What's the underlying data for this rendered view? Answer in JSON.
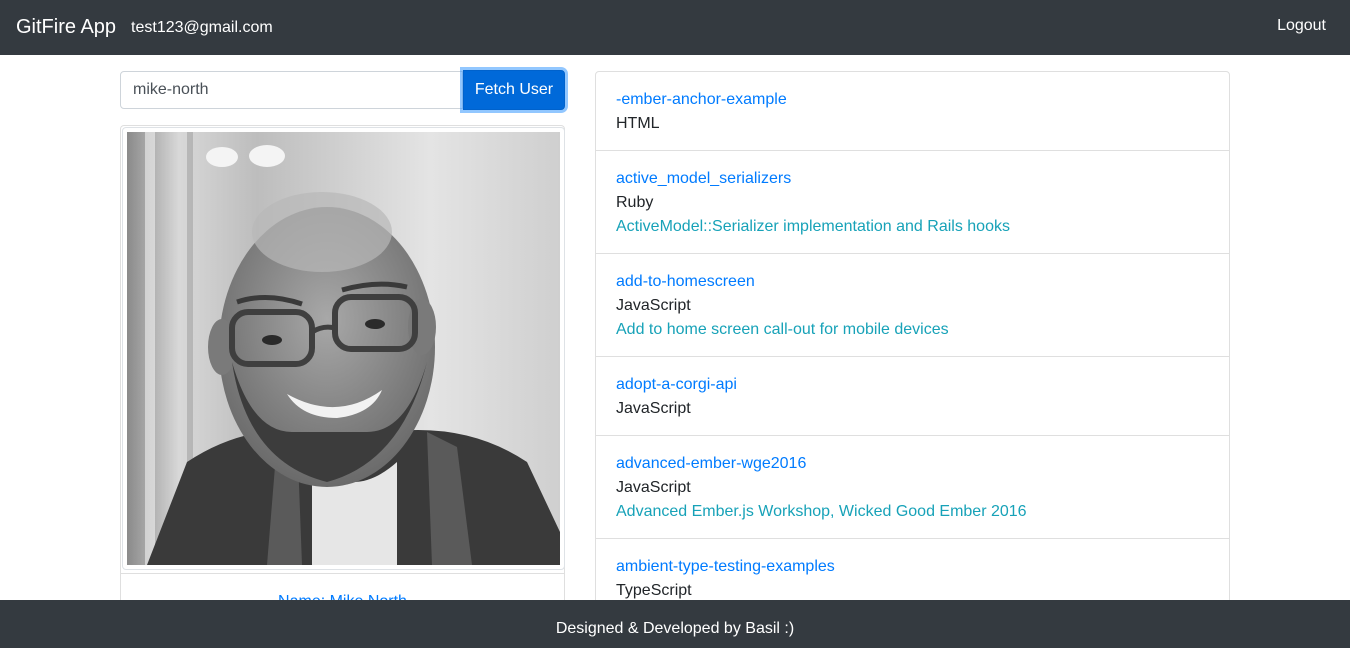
{
  "navbar": {
    "brand": "GitFire App",
    "user_email": "test123@gmail.com",
    "logout_label": "Logout"
  },
  "search": {
    "value": "mike-north",
    "button_label": "Fetch User"
  },
  "profile": {
    "photo_alt": "user avatar",
    "name_label": "Name: Mike North"
  },
  "repos": [
    {
      "name": "-ember-anchor-example",
      "language": "HTML",
      "description": ""
    },
    {
      "name": "active_model_serializers",
      "language": "Ruby",
      "description": "ActiveModel::Serializer implementation and Rails hooks"
    },
    {
      "name": "add-to-homescreen",
      "language": "JavaScript",
      "description": "Add to home screen call-out for mobile devices"
    },
    {
      "name": "adopt-a-corgi-api",
      "language": "JavaScript",
      "description": ""
    },
    {
      "name": "advanced-ember-wge2016",
      "language": "JavaScript",
      "description": "Advanced Ember.js Workshop, Wicked Good Ember 2016"
    },
    {
      "name": "ambient-type-testing-examples",
      "language": "TypeScript",
      "description": ""
    }
  ],
  "footer": {
    "text": "Designed & Developed by Basil :)"
  },
  "colors": {
    "navbar_bg": "#343a40",
    "link": "#007bff",
    "description": "#17a2b8",
    "button": "#0069d9"
  }
}
